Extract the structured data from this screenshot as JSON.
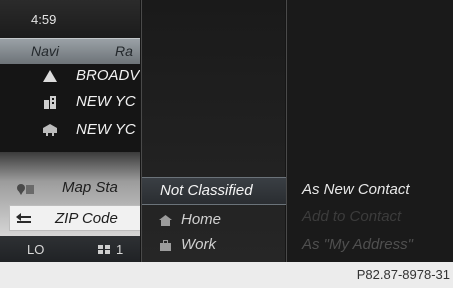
{
  "header": {
    "clock": "4:59"
  },
  "tabs": [
    {
      "label": "Navi"
    },
    {
      "label": "Ra"
    }
  ],
  "poi_list": [
    {
      "icon": "triangle-icon",
      "label": "BROADV"
    },
    {
      "icon": "building-icon",
      "label": "NEW YC"
    },
    {
      "icon": "landmark-icon",
      "label": "NEW YC"
    }
  ],
  "left_menu": {
    "map_item": {
      "icon": "map-icon",
      "label": "Map Sta"
    },
    "zip_item": {
      "icon": "back-arrow-icon",
      "label": "ZIP Code"
    }
  },
  "status_bar": {
    "mode": "LO",
    "channel_icon": "radio-channel-icon",
    "channel": "1"
  },
  "category_menu": {
    "selected": "Not Classified",
    "items": [
      {
        "icon": "home-icon",
        "label": "Home"
      },
      {
        "icon": "work-icon",
        "label": "Work"
      }
    ]
  },
  "action_menu": {
    "items": [
      {
        "label": "As New Contact",
        "state": "active"
      },
      {
        "label": "Add to Contact",
        "state": "disabled"
      },
      {
        "label": "As \"My Address\"",
        "state": "disabled"
      }
    ]
  },
  "caption": {
    "reference": "P82.87-8978-31"
  },
  "colors": {
    "background": "#161616",
    "tab_bar": "#8a9095",
    "highlight": "#3a3f44",
    "text_active": "#f4f4f4",
    "text_disabled": "#3c3c3c"
  }
}
